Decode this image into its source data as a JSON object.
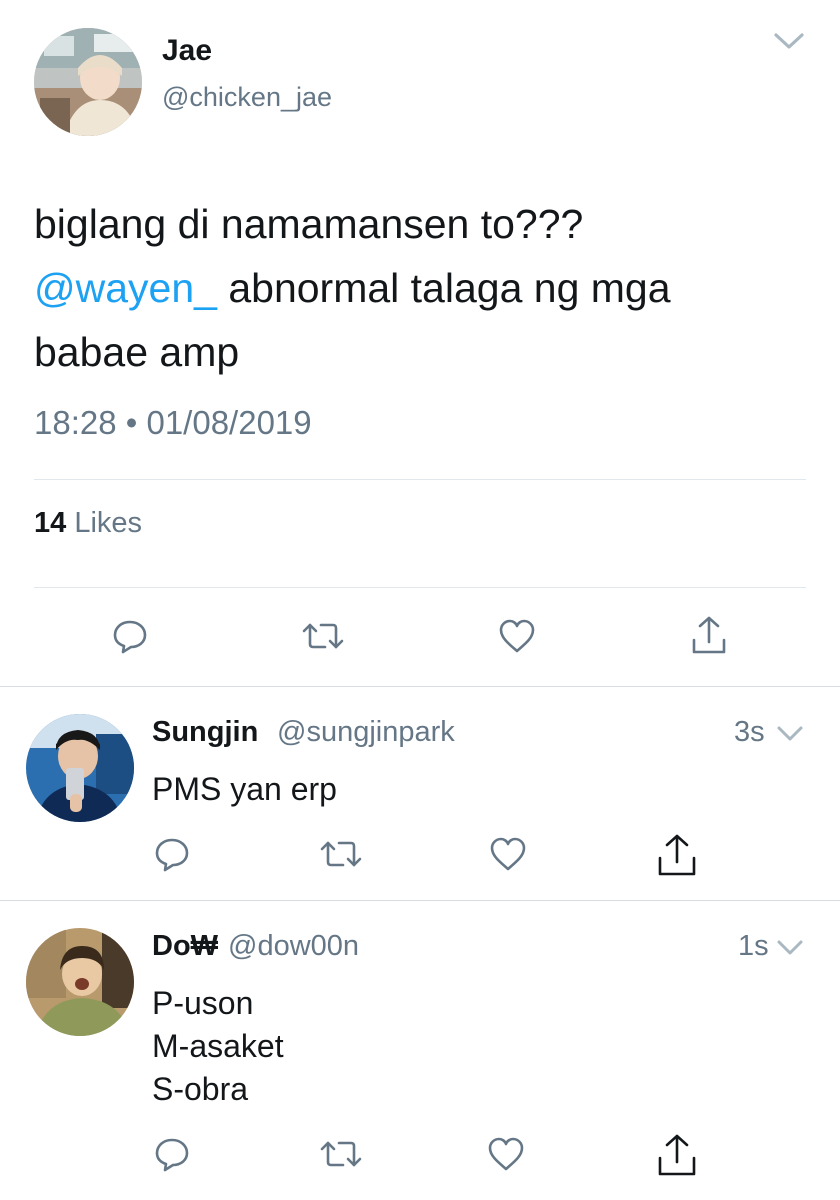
{
  "main_tweet": {
    "author_name": "Jae",
    "author_handle": "@chicken_jae",
    "text_line1": "biglang di namamansen to???",
    "mention": "@wayen_",
    "text_line2_rest": " abnormal talaga ng mga",
    "text_line3": "babae amp",
    "timestamp": "18:28 • 01/08/2019",
    "likes_count": "14",
    "likes_label": " Likes"
  },
  "replies": [
    {
      "author_name": "Sungjin",
      "author_handle": "@sungjinpark",
      "time": "3s",
      "lines": [
        "PMS yan erp"
      ]
    },
    {
      "author_name": "Do₩",
      "author_handle": "@dow00n",
      "time": "1s",
      "lines": [
        "P-uson",
        "M-asaket",
        "S-obra"
      ]
    }
  ],
  "colors": {
    "mention_blue": "#1da1f2",
    "secondary_gray": "#657786",
    "divider": "#e1e8ed"
  }
}
